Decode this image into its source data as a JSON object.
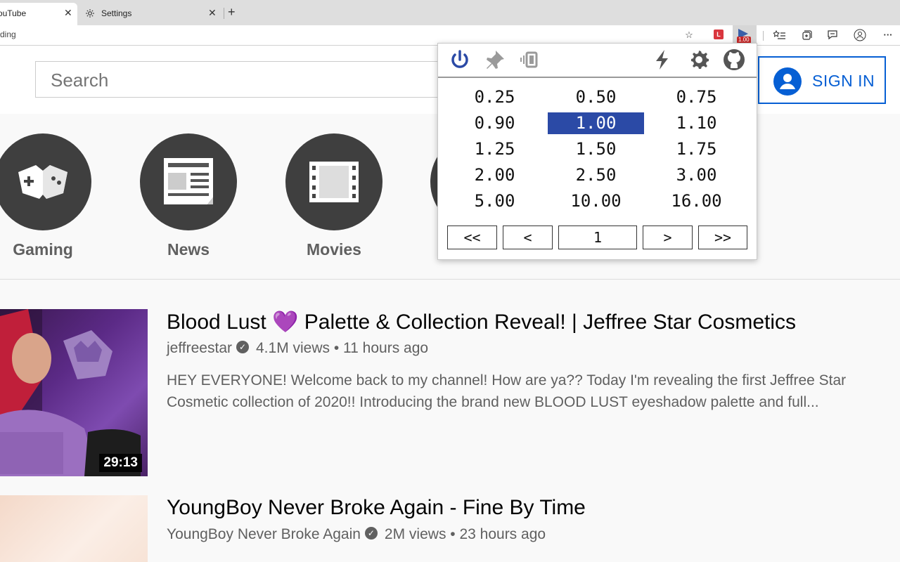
{
  "browser": {
    "tabs": [
      {
        "title": "YouTube",
        "active": true
      },
      {
        "title": "Settings",
        "active": false
      }
    ],
    "address_text": "ding",
    "speed_badge": "1.00",
    "ext_l_label": "L"
  },
  "youtube": {
    "search_placeholder": "Search",
    "signin_label": "SIGN IN",
    "categories": [
      {
        "label": "Gaming"
      },
      {
        "label": "News"
      },
      {
        "label": "Movies"
      }
    ],
    "videos": [
      {
        "title": "Blood Lust 💜 Palette & Collection Reveal! | Jeffree Star Cosmetics",
        "channel": "jeffreestar",
        "meta": "4.1M views • 11 hours ago",
        "description": "HEY EVERYONE! Welcome back to my channel! How are ya?? Today I'm revealing the first Jeffree Star Cosmetic collection of 2020!! Introducing the brand new BLOOD LUST eyeshadow palette and full...",
        "duration": "29:13"
      },
      {
        "title": "YoungBoy Never Broke Again - Fine By Time",
        "channel": "YoungBoy Never Broke Again",
        "meta": "2M views • 23 hours ago"
      }
    ]
  },
  "popup": {
    "speeds": [
      "0.25",
      "0.50",
      "0.75",
      "0.90",
      "1.00",
      "1.10",
      "1.25",
      "1.50",
      "1.75",
      "2.00",
      "2.50",
      "3.00",
      "5.00",
      "10.00",
      "16.00"
    ],
    "selected_speed": "1.00",
    "nav": {
      "first": "<<",
      "prev": "<",
      "value": "1",
      "next": ">",
      "last": ">>"
    }
  },
  "colors": {
    "accent_blue": "#065fd4",
    "popup_selected": "#2b4aa6",
    "icon_blue": "#2b4aa6",
    "icon_gray": "#555555"
  }
}
